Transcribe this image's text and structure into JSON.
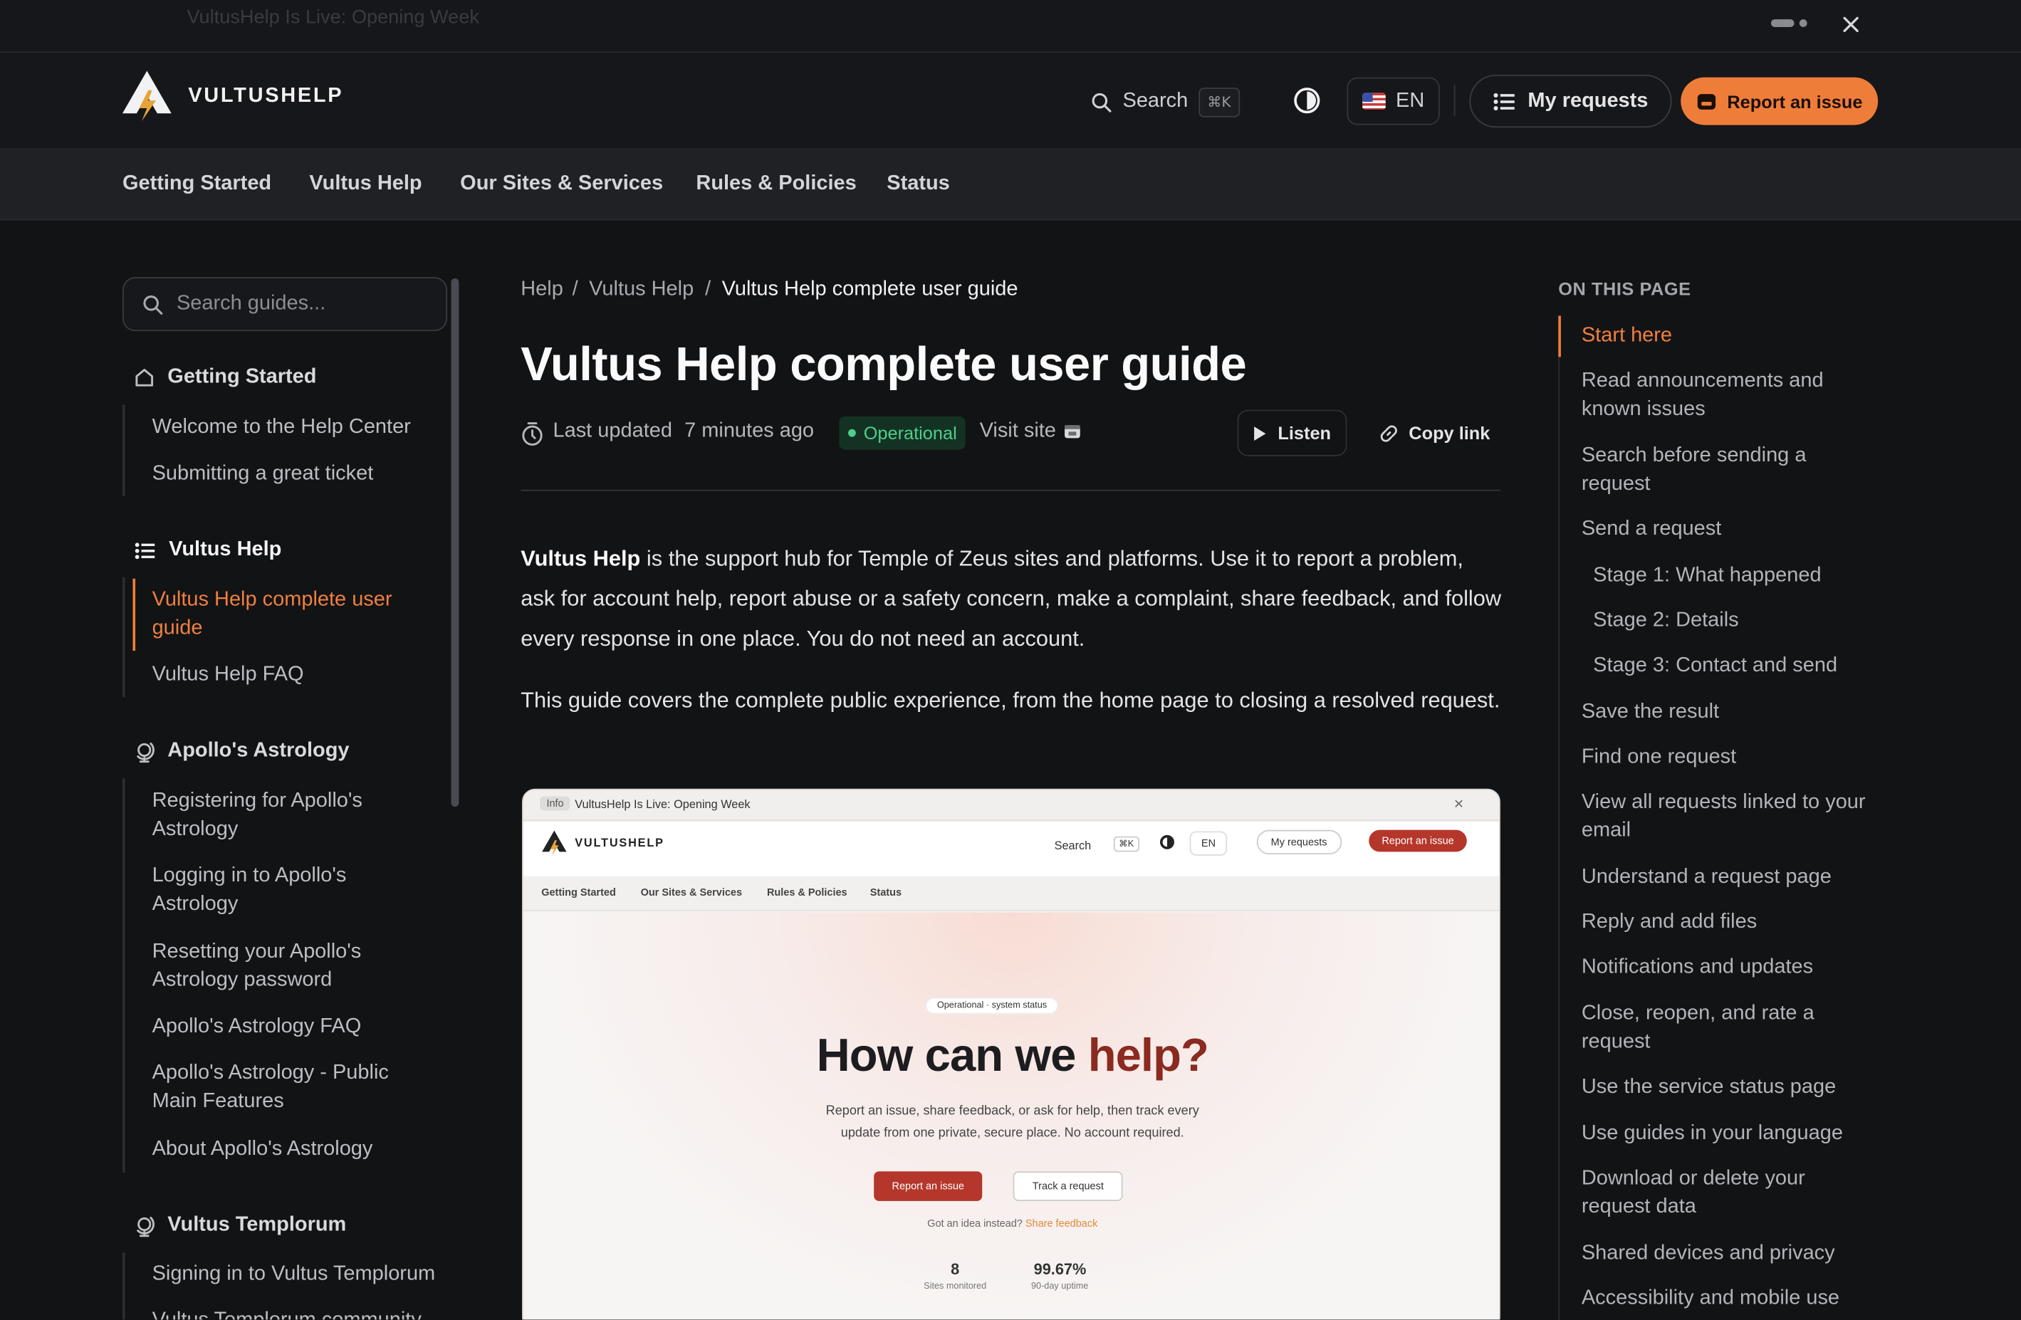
{
  "announcement": {
    "text": "VultusHelp Is Live: Opening Week"
  },
  "brand": {
    "name": "VULTUSHELP",
    "accent": "#ef7d3a"
  },
  "header": {
    "search_label": "Search",
    "search_kbd": "⌘K",
    "lang": "EN",
    "my_requests": "My requests",
    "report": "Report an issue"
  },
  "nav": [
    "Getting Started",
    "Vultus Help",
    "Our Sites & Services",
    "Rules & Policies",
    "Status"
  ],
  "sidebar": {
    "search_placeholder": "Search guides...",
    "groups": [
      {
        "title": "Getting Started",
        "items": [
          "Welcome to the Help Center",
          "Submitting a great ticket"
        ]
      },
      {
        "title": "Vultus Help",
        "items": [
          "Vultus Help complete user guide",
          "Vultus Help FAQ"
        ]
      },
      {
        "title": "Apollo's Astrology",
        "items": [
          "Registering for Apollo's Astrology",
          "Logging in to Apollo's Astrology",
          "Resetting your Apollo's Astrology password",
          "Apollo's Astrology FAQ",
          "Apollo's Astrology - Public Main Features",
          "About Apollo's Astrology"
        ]
      },
      {
        "title": "Vultus Templorum",
        "items": [
          "Signing in to Vultus Templorum",
          "Vultus Templorum community"
        ]
      }
    ]
  },
  "breadcrumb": [
    "Help",
    "Vultus Help",
    "Vultus Help complete user guide"
  ],
  "article": {
    "title": "Vultus Help complete user guide",
    "updated_label": "Last updated",
    "updated_value": "7 minutes ago",
    "status": "Operational",
    "visit_site": "Visit site",
    "listen": "Listen",
    "copy_link": "Copy link",
    "intro_strong": "Vultus Help",
    "intro_rest": " is the support hub for Temple of Zeus sites and platforms. Use it to report a problem, ask for account help, report abuse or a safety concern, make a complaint, share feedback, and follow every response in one place. You do not need an account.",
    "para2": "This guide covers the complete public experience, from the home page to closing a resolved request."
  },
  "screenshot": {
    "info_tag": "Info",
    "announce": "VultusHelp Is Live: Opening Week",
    "brand": "VULTUSHELP",
    "search": "Search",
    "kbd": "⌘K",
    "lang": "EN",
    "my_requests": "My requests",
    "report": "Report an issue",
    "nav": [
      "Getting Started",
      "Our Sites & Services",
      "Rules & Policies",
      "Status"
    ],
    "status_chip": "Operational · system status",
    "hero_a": "How can we ",
    "hero_b": "help?",
    "sub1": "Report an issue, share feedback, or ask for help, then track every",
    "sub2": "update from one private, secure place. No account required.",
    "btn_report": "Report an issue",
    "btn_track": "Track a request",
    "idea": "Got an idea instead?",
    "idea_link": "Share feedback",
    "stat1_val": "8",
    "stat1_lbl": "Sites monitored",
    "stat2_val": "99.67%",
    "stat2_lbl": "90-day uptime"
  },
  "toc": {
    "title": "ON THIS PAGE",
    "items": [
      "Start here",
      "Read announcements and known issues",
      "Search before sending a request",
      "Send a request",
      "Stage 1: What happened",
      "Stage 2: Details",
      "Stage 3: Contact and send",
      "Save the result",
      "Find one request",
      "View all requests linked to your email",
      "Understand a request page",
      "Reply and add files",
      "Notifications and updates",
      "Close, reopen, and rate a request",
      "Use the service status page",
      "Use guides in your language",
      "Download or delete your request data",
      "Shared devices and privacy",
      "Accessibility and mobile use"
    ]
  }
}
